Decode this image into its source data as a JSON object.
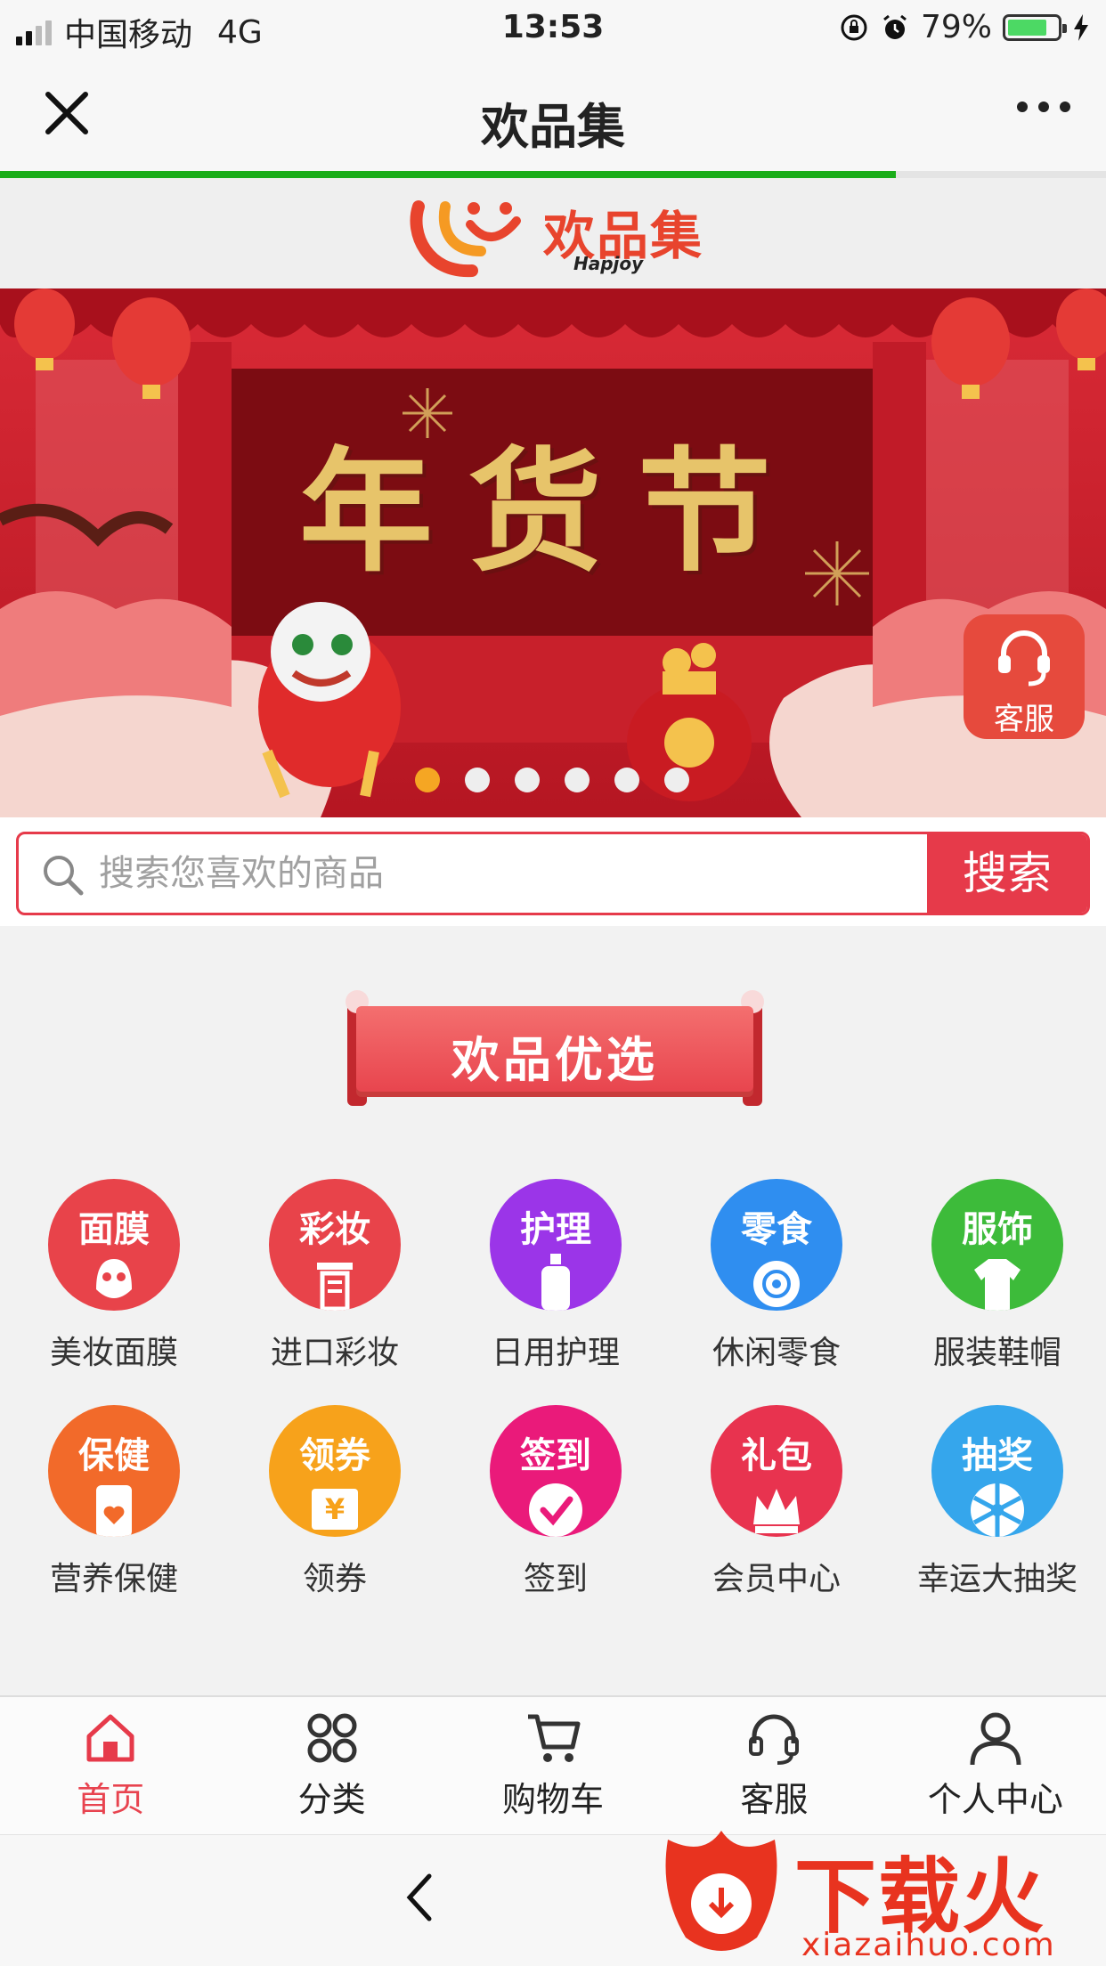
{
  "status_bar": {
    "carrier": "中国移动",
    "network": "4G",
    "time": "13:53",
    "battery": "79%",
    "battery_level": 0.79
  },
  "nav": {
    "title": "欢品集",
    "load_progress": 0.81
  },
  "logo": {
    "name": "欢品集",
    "tagline": "Hapjoy"
  },
  "banner": {
    "headline": "年货节",
    "slide_count": 6,
    "active_slide": 1,
    "service_label": "客服"
  },
  "search": {
    "placeholder": "搜索您喜欢的商品",
    "button": "搜索"
  },
  "section": {
    "title": "欢品优选",
    "items": [
      {
        "badge": "面膜",
        "label": "美妆面膜",
        "icon": "mask-icon",
        "color": "#e8434a"
      },
      {
        "badge": "彩妆",
        "label": "进口彩妆",
        "icon": "lipstick-icon",
        "color": "#e8434a"
      },
      {
        "badge": "护理",
        "label": "日用护理",
        "icon": "lotion-bottle-icon",
        "color": "#9b35e8"
      },
      {
        "badge": "零食",
        "label": "休闲零食",
        "icon": "snack-icon",
        "color": "#2f8ef0"
      },
      {
        "badge": "服饰",
        "label": "服装鞋帽",
        "icon": "tshirt-icon",
        "color": "#3dbb3a"
      },
      {
        "badge": "保健",
        "label": "营养保健",
        "icon": "health-icon",
        "color": "#f26a2a"
      },
      {
        "badge": "领券",
        "label": "领券",
        "icon": "coupon-icon",
        "color": "#f7a21b"
      },
      {
        "badge": "签到",
        "label": "签到",
        "icon": "checkmark-icon",
        "color": "#ea1a7a"
      },
      {
        "badge": "礼包",
        "label": "会员中心",
        "icon": "crown-icon",
        "color": "#e8334f"
      },
      {
        "badge": "抽奖",
        "label": "幸运大抽奖",
        "icon": "wheel-icon",
        "color": "#35a6ec"
      }
    ]
  },
  "tabbar": {
    "tabs": [
      {
        "label": "首页",
        "icon": "home-icon",
        "active": true
      },
      {
        "label": "分类",
        "icon": "category-icon",
        "active": false
      },
      {
        "label": "购物车",
        "icon": "cart-icon",
        "active": false
      },
      {
        "label": "客服",
        "icon": "headset-icon",
        "active": false
      },
      {
        "label": "个人中心",
        "icon": "user-icon",
        "active": false
      }
    ]
  },
  "watermark": {
    "brand": "下载火",
    "url": "xiazaihuo.com"
  },
  "colors": {
    "accent": "#e63a4a",
    "progress": "#1aad19",
    "active_dot": "#f5a623"
  }
}
